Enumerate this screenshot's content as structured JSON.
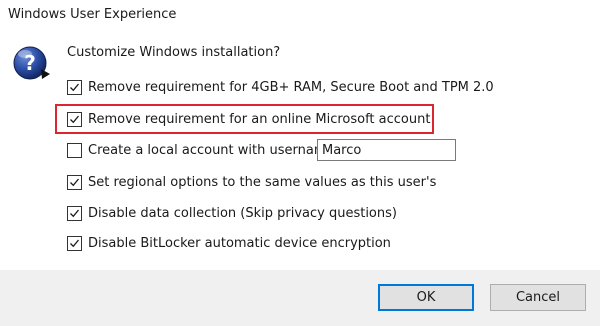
{
  "window": {
    "title": "Windows User Experience"
  },
  "dialog": {
    "icon": "question-icon",
    "prompt": "Customize Windows installation?",
    "options": [
      {
        "label": "Remove requirement for 4GB+ RAM, Secure Boot and TPM 2.0",
        "checked": true
      },
      {
        "label": "Remove requirement for an online Microsoft account",
        "checked": true,
        "highlighted": true
      },
      {
        "label": "Create a local account with username:",
        "checked": false
      },
      {
        "label": "Set regional options to the same values as this user's",
        "checked": true
      },
      {
        "label": "Disable data collection (Skip privacy questions)",
        "checked": true
      },
      {
        "label": "Disable BitLocker automatic device encryption",
        "checked": true
      }
    ],
    "username_value": "Marco"
  },
  "buttons": {
    "ok_label": "OK",
    "cancel_label": "Cancel"
  },
  "colors": {
    "highlight": "#d9262f",
    "accent": "#0078d7",
    "footer": "#f0f0f0"
  }
}
